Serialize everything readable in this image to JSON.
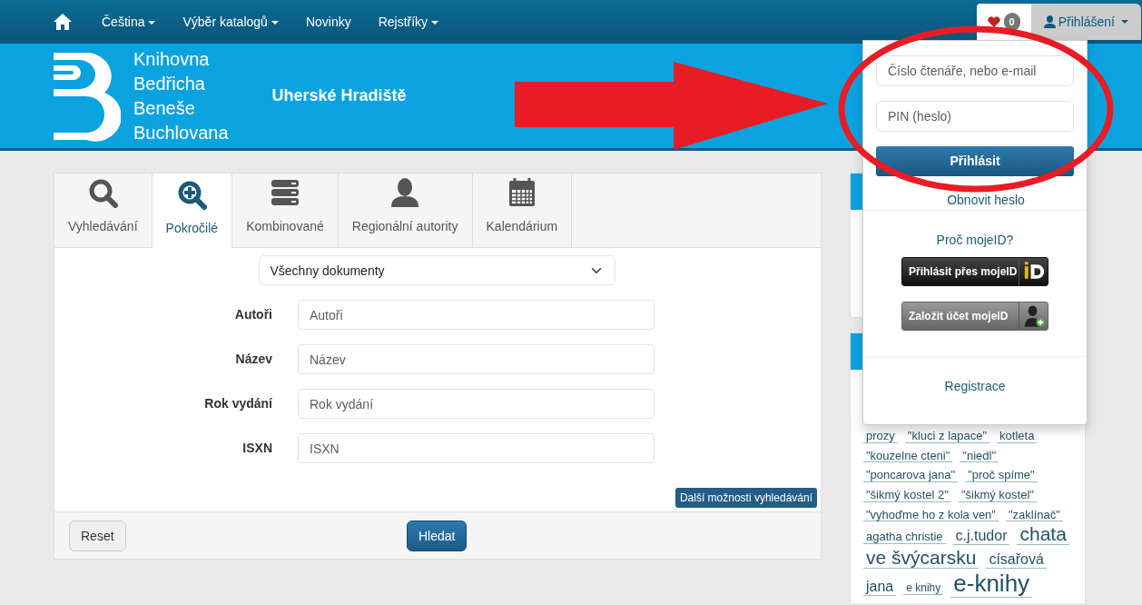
{
  "nav": {
    "menu": [
      {
        "label": "Čeština",
        "dropdown": true
      },
      {
        "label": "Výběr katalogů",
        "dropdown": true
      },
      {
        "label": "Novinky",
        "dropdown": false
      },
      {
        "label": "Rejstříky",
        "dropdown": true
      }
    ],
    "favorites_count": "0",
    "login_label": "Přihlášení"
  },
  "banner": {
    "logo_lines": [
      "Knihovna",
      "Bedřicha",
      "Beneše",
      "Buchlovana"
    ],
    "city": "Uherské Hradiště"
  },
  "tabs": [
    {
      "label": "Vyhledávání",
      "selected": false
    },
    {
      "label": "Pokročilé",
      "selected": true
    },
    {
      "label": "Kombinované",
      "selected": false
    },
    {
      "label": "Regionální autority",
      "selected": false
    },
    {
      "label": "Kalendárium",
      "selected": false
    }
  ],
  "form": {
    "document_type": "Všechny dokumenty",
    "fields": [
      {
        "label": "Autoři",
        "placeholder": "Autoři"
      },
      {
        "label": "Název",
        "placeholder": "Název"
      },
      {
        "label": "Rok vydání",
        "placeholder": "Rok vydání"
      },
      {
        "label": "ISXN",
        "placeholder": "ISXN"
      }
    ],
    "more_button": "Další možnosti vyhledávání",
    "reset": "Reset",
    "submit": "Hledat"
  },
  "login": {
    "reader_placeholder": "Číslo čtenáře, nebo e-mail",
    "pin_placeholder": "PIN (heslo)",
    "submit": "Přihlásit",
    "reset_link": "Obnovit heslo",
    "why_link": "Proč mojeID?",
    "mojeid_login": "Přihlásit přes mojeID",
    "mojeid_create": "Založit účet mojeID",
    "register": "Registrace"
  },
  "tag_cloud": [
    {
      "text": "prozy",
      "kind": "small"
    },
    {
      "text": "\"kluci z lapace\"",
      "kind": "small"
    },
    {
      "text": "kotleta",
      "kind": "small"
    },
    {
      "text": "\"kouzelne cteni\"",
      "kind": "small"
    },
    {
      "text": "\"niedl\"",
      "kind": "small"
    },
    {
      "text": "\"poncarova jana\"",
      "kind": "small"
    },
    {
      "text": "\"proč spíme\"",
      "kind": "small"
    },
    {
      "text": "\"šikmý kostel 2\"",
      "kind": "small"
    },
    {
      "text": "\"šikmý kostel\"",
      "kind": "small"
    },
    {
      "text": "\"vyhoďme ho z kola ven\"",
      "kind": "small"
    },
    {
      "text": "\"zaklínač\"",
      "kind": "small"
    },
    {
      "text": "agatha christie",
      "kind": "small"
    },
    {
      "text": "c.j.tudor",
      "kind": "medium"
    },
    {
      "text": "chata",
      "kind": "large"
    },
    {
      "text": "ve švýcarsku",
      "kind": "large"
    },
    {
      "text": "císařová",
      "kind": "medium"
    },
    {
      "text": "jana",
      "kind": "medium"
    },
    {
      "text": "e knihy",
      "kind": "tiny"
    },
    {
      "text": "e-knihy",
      "kind": "huge"
    }
  ]
}
